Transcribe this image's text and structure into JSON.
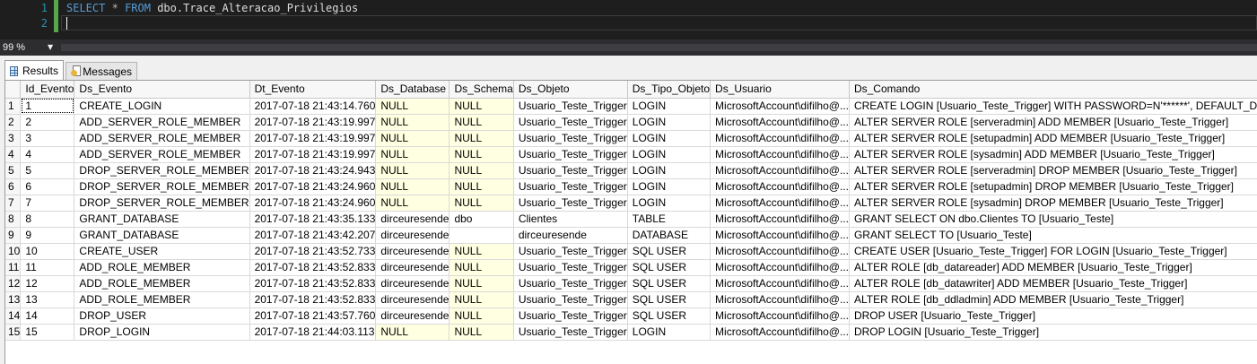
{
  "editor": {
    "line_numbers": [
      "1",
      "2"
    ],
    "sql": {
      "select": "SELECT",
      "star": "*",
      "from": "FROM",
      "table": "dbo.Trace_Alteracao_Privilegios"
    }
  },
  "zoom": {
    "value": "99 %"
  },
  "tabs": [
    {
      "label": "Results",
      "icon": "grid-icon"
    },
    {
      "label": "Messages",
      "icon": "messages-icon"
    }
  ],
  "grid": {
    "columns": [
      "Id_Evento",
      "Ds_Evento",
      "Dt_Evento",
      "Ds_Database",
      "Ds_Schema",
      "Ds_Objeto",
      "Ds_Tipo_Objeto",
      "Ds_Usuario",
      "Ds_Comando"
    ],
    "rows": [
      [
        "1",
        "1",
        "CREATE_LOGIN",
        "2017-07-18 21:43:14.760",
        "NULL",
        "NULL",
        "Usuario_Teste_Trigger",
        "LOGIN",
        "MicrosoftAccount\\difilho@...",
        "CREATE LOGIN [Usuario_Teste_Trigger] WITH PASSWORD=N'******', DEFAULT_DATA..."
      ],
      [
        "2",
        "2",
        "ADD_SERVER_ROLE_MEMBER",
        "2017-07-18 21:43:19.997",
        "NULL",
        "NULL",
        "Usuario_Teste_Trigger",
        "LOGIN",
        "MicrosoftAccount\\difilho@...",
        "ALTER SERVER ROLE [serveradmin] ADD MEMBER [Usuario_Teste_Trigger]"
      ],
      [
        "3",
        "3",
        "ADD_SERVER_ROLE_MEMBER",
        "2017-07-18 21:43:19.997",
        "NULL",
        "NULL",
        "Usuario_Teste_Trigger",
        "LOGIN",
        "MicrosoftAccount\\difilho@...",
        "ALTER SERVER ROLE [setupadmin] ADD MEMBER [Usuario_Teste_Trigger]"
      ],
      [
        "4",
        "4",
        "ADD_SERVER_ROLE_MEMBER",
        "2017-07-18 21:43:19.997",
        "NULL",
        "NULL",
        "Usuario_Teste_Trigger",
        "LOGIN",
        "MicrosoftAccount\\difilho@...",
        "ALTER SERVER ROLE [sysadmin] ADD MEMBER [Usuario_Teste_Trigger]"
      ],
      [
        "5",
        "5",
        "DROP_SERVER_ROLE_MEMBER",
        "2017-07-18 21:43:24.943",
        "NULL",
        "NULL",
        "Usuario_Teste_Trigger",
        "LOGIN",
        "MicrosoftAccount\\difilho@...",
        "ALTER SERVER ROLE [serveradmin] DROP MEMBER [Usuario_Teste_Trigger]"
      ],
      [
        "6",
        "6",
        "DROP_SERVER_ROLE_MEMBER",
        "2017-07-18 21:43:24.960",
        "NULL",
        "NULL",
        "Usuario_Teste_Trigger",
        "LOGIN",
        "MicrosoftAccount\\difilho@...",
        "ALTER SERVER ROLE [setupadmin] DROP MEMBER [Usuario_Teste_Trigger]"
      ],
      [
        "7",
        "7",
        "DROP_SERVER_ROLE_MEMBER",
        "2017-07-18 21:43:24.960",
        "NULL",
        "NULL",
        "Usuario_Teste_Trigger",
        "LOGIN",
        "MicrosoftAccount\\difilho@...",
        "ALTER SERVER ROLE [sysadmin] DROP MEMBER [Usuario_Teste_Trigger]"
      ],
      [
        "8",
        "8",
        "GRANT_DATABASE",
        "2017-07-18 21:43:35.133",
        "dirceuresende",
        "dbo",
        "Clientes",
        "TABLE",
        "MicrosoftAccount\\difilho@...",
        "GRANT SELECT ON dbo.Clientes TO [Usuario_Teste]"
      ],
      [
        "9",
        "9",
        "GRANT_DATABASE",
        "2017-07-18 21:43:42.207",
        "dirceuresende",
        "",
        "dirceuresende",
        "DATABASE",
        "MicrosoftAccount\\difilho@...",
        "GRANT SELECT TO [Usuario_Teste]"
      ],
      [
        "10",
        "10",
        "CREATE_USER",
        "2017-07-18 21:43:52.733",
        "dirceuresende",
        "NULL",
        "Usuario_Teste_Trigger",
        "SQL USER",
        "MicrosoftAccount\\difilho@...",
        "CREATE USER [Usuario_Teste_Trigger] FOR LOGIN [Usuario_Teste_Trigger]"
      ],
      [
        "11",
        "11",
        "ADD_ROLE_MEMBER",
        "2017-07-18 21:43:52.833",
        "dirceuresende",
        "NULL",
        "Usuario_Teste_Trigger",
        "SQL USER",
        "MicrosoftAccount\\difilho@...",
        "ALTER ROLE [db_datareader] ADD MEMBER [Usuario_Teste_Trigger]"
      ],
      [
        "12",
        "12",
        "ADD_ROLE_MEMBER",
        "2017-07-18 21:43:52.833",
        "dirceuresende",
        "NULL",
        "Usuario_Teste_Trigger",
        "SQL USER",
        "MicrosoftAccount\\difilho@...",
        "ALTER ROLE [db_datawriter] ADD MEMBER [Usuario_Teste_Trigger]"
      ],
      [
        "13",
        "13",
        "ADD_ROLE_MEMBER",
        "2017-07-18 21:43:52.833",
        "dirceuresende",
        "NULL",
        "Usuario_Teste_Trigger",
        "SQL USER",
        "MicrosoftAccount\\difilho@...",
        "ALTER ROLE [db_ddladmin] ADD MEMBER [Usuario_Teste_Trigger]"
      ],
      [
        "14",
        "14",
        "DROP_USER",
        "2017-07-18 21:43:57.760",
        "dirceuresende",
        "NULL",
        "Usuario_Teste_Trigger",
        "SQL USER",
        "MicrosoftAccount\\difilho@...",
        "DROP USER [Usuario_Teste_Trigger]"
      ],
      [
        "15",
        "15",
        "DROP_LOGIN",
        "2017-07-18 21:44:03.113",
        "NULL",
        "NULL",
        "Usuario_Teste_Trigger",
        "LOGIN",
        "MicrosoftAccount\\difilho@...",
        "DROP LOGIN [Usuario_Teste_Trigger]"
      ]
    ]
  }
}
